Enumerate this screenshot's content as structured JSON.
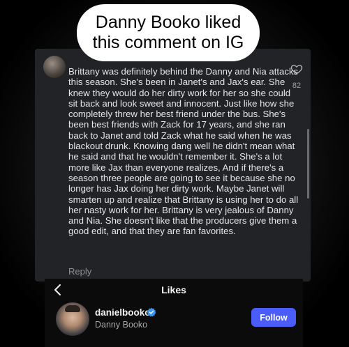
{
  "caption": {
    "line1": "Danny Booko liked",
    "line2": "this comment on IG"
  },
  "comment": {
    "text": "Brittany was definitely behind the Danny and Nia attacks this season. She's been in Janet's and Jax's ear. She knew they would do her dirty work for her so she could sit back and look sweet and innocent. Just like how she completely threw her best friend under the bus. She's been best friends with Zack for 17 years, and she ran back to Janet and told Zack what he said when he was blackout drunk. Knowing dang well he didn't mean what he said and that he wouldn't remember it. She's a lot more like Jax than everyone realizes, And if there's a season three people are going to see it because she no longer has Jax doing her dirty work. Maybe Janet will smarten up and realize that Brittany is using her to do all her nasty work for her. Brittany is very jealous of Danny and Nia. She doesn't like that the producers give them a good edit, and that they are fan favorites.",
    "reply_label": "Reply",
    "like_count": "82",
    "icons": {
      "like": "heart-icon"
    }
  },
  "likes_sheet": {
    "title": "Likes",
    "back_icon": "chevron-left-icon",
    "users": [
      {
        "username": "danielbooko",
        "display_name": "Danny Booko",
        "verified": true,
        "follow_label": "Follow"
      }
    ]
  },
  "colors": {
    "follow_button": "#4a5df9",
    "verified_badge": "#3897f0",
    "panel_background": "#222327"
  }
}
